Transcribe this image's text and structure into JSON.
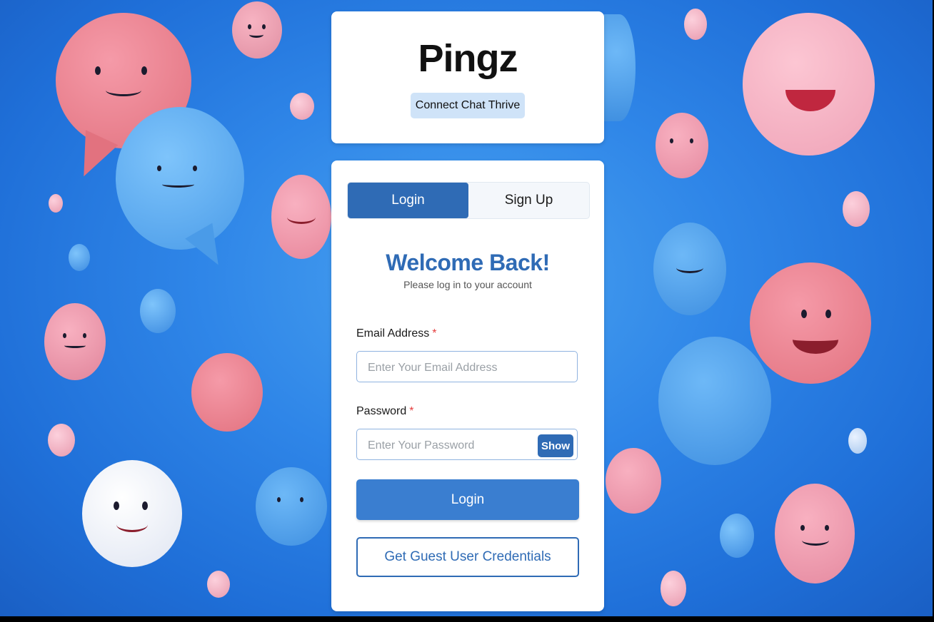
{
  "app": {
    "title": "Pingz",
    "tagline": "Connect Chat Thrive"
  },
  "tabs": [
    {
      "label": "Login",
      "active": true
    },
    {
      "label": "Sign Up",
      "active": false
    }
  ],
  "login": {
    "heading": "Welcome Back!",
    "subheading": "Please log in to your account",
    "email": {
      "label": "Email Address",
      "required_mark": "*",
      "value": "",
      "placeholder": "Enter Your Email Address"
    },
    "password": {
      "label": "Password",
      "required_mark": "*",
      "value": "",
      "placeholder": "Enter Your Password",
      "toggle_label": "Show"
    },
    "submit_label": "Login",
    "guest_label": "Get Guest User Credentials"
  },
  "colors": {
    "primary": "#2f6bb5",
    "button": "#3a7ed0",
    "tagline_bg": "#cfe3f8",
    "background": "#2f86e8",
    "required": "#e53e3e"
  },
  "background_icons": [
    "pink-chat-bubble-icon",
    "blue-chat-bubble-icon",
    "white-chat-bubble-icon",
    "emoji-face-icon"
  ]
}
